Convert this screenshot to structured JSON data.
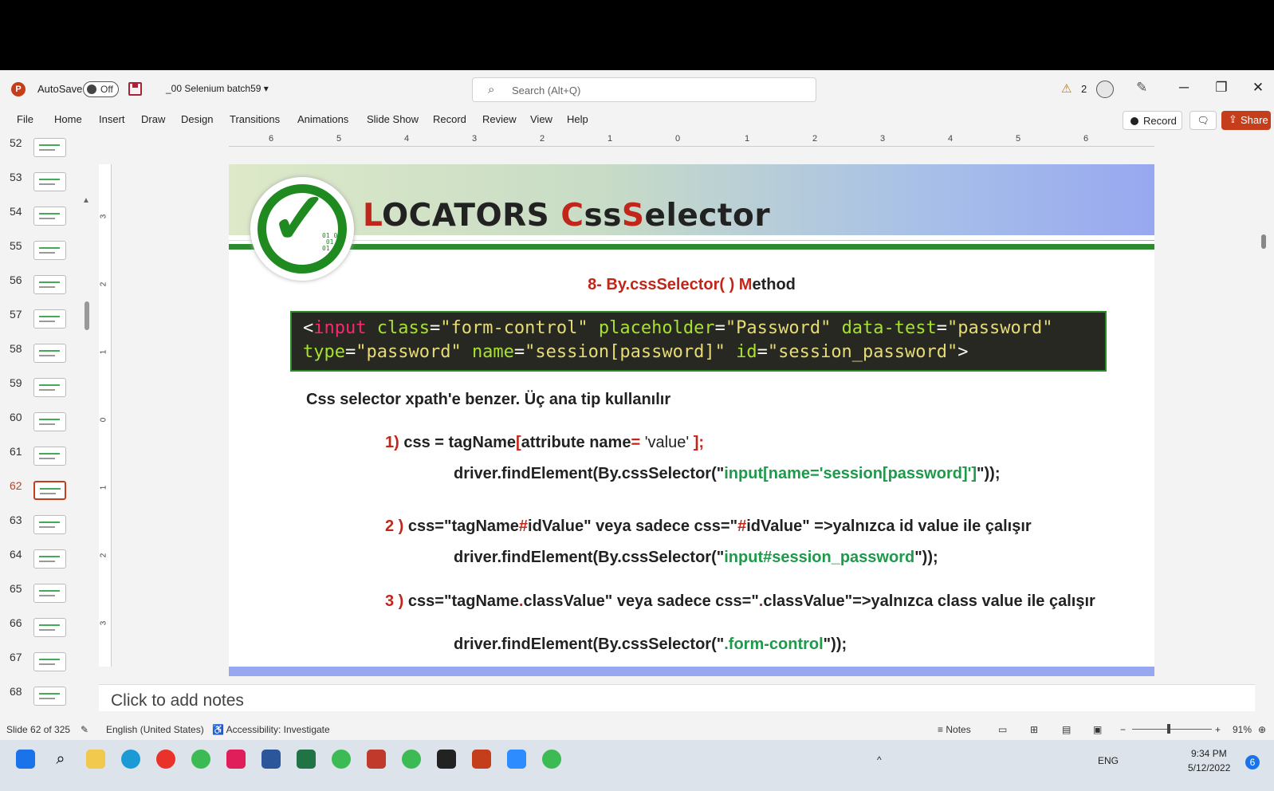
{
  "titlebar": {
    "app_logo": "P",
    "autosave_label": "AutoSave",
    "autosave_state": "Off",
    "file_name": "_00 Selenium batch59",
    "search_placeholder": "Search (Alt+Q)",
    "warnings_count": "2"
  },
  "menu": {
    "items": [
      "File",
      "Home",
      "Insert",
      "Draw",
      "Design",
      "Transitions",
      "Animations",
      "Slide Show",
      "Record",
      "Review",
      "View",
      "Help"
    ],
    "record_label": "Record",
    "share_label": "Share"
  },
  "thumbnails": {
    "numbers": [
      "52",
      "53",
      "54",
      "55",
      "56",
      "57",
      "58",
      "59",
      "60",
      "61",
      "62",
      "63",
      "64",
      "65",
      "66",
      "67",
      "68"
    ],
    "selected": "62"
  },
  "ruler": {
    "marks": [
      "6",
      "5",
      "4",
      "3",
      "2",
      "1",
      "0",
      "1",
      "2",
      "3",
      "4",
      "5",
      "6"
    ],
    "vertical_marks": [
      "3",
      "2",
      "1",
      "0",
      "1",
      "2",
      "3"
    ]
  },
  "slide": {
    "title_parts": [
      "L",
      "OCATORS ",
      "C",
      "ss",
      "S",
      "elector"
    ],
    "check_bits": "01 01\n 01\n01",
    "subtitle_red": "8- By.cssSelector( ) M",
    "subtitle_black": "ethod",
    "code": {
      "lt": "<",
      "tag": "input",
      "a1": "class",
      "v1": "\"form-control\"",
      "a2": "placeholder",
      "v2": "\"Password\"",
      "a3": "data-test",
      "v3": "\"password\"",
      "a4": "type",
      "v4": "\"password\"",
      "a5": "name",
      "v5": "\"session[password]\"",
      "a6": "id",
      "v6": "\"session_password\"",
      "gt": ">",
      "eq": "="
    },
    "intro": "Css selector xpath'e benzer. Üç ana tip kullanılır",
    "l1a": "1) ",
    "l1b": "css = tagName",
    "l1c": "[",
    "l1d": "attribute name",
    "l1e": "= ",
    "l1f": "'value'",
    "l1g": " ];",
    "l2a": "driver.findElement(By.cssSelector(\"",
    "l2b": "input[name='session[password]']",
    "l2c": "\"));",
    "l3a": "2 ) ",
    "l3b": "css=\"tagName",
    "l3c": "#",
    "l3d": "idValue\" veya sadece css=\"",
    "l3e": "#",
    "l3f": "idValue\" =>yalnızca id value ile çalışır",
    "l4a": "driver.findElement(By.cssSelector(\"",
    "l4b": "input#session_password",
    "l4c": "\"));",
    "l5a": "3 ) ",
    "l5b": "css=\"tagName",
    "l5c": ".",
    "l5d": "classValue\" veya sadece css=\"",
    "l5e": ".",
    "l5f": "classValue\"=>yalnızca class value ile çalışır",
    "l6a": "driver.findElement(By.cssSelector(\"",
    "l6b": ".form-control",
    "l6c": "\"));"
  },
  "notes_placeholder": "Click to add notes",
  "status": {
    "slide_info": "Slide 62 of 325",
    "language": "English (United States)",
    "accessibility": "Accessibility: Investigate",
    "notes_label": "Notes",
    "zoom": "91%"
  },
  "taskbar": {
    "lang": "ENG",
    "time": "9:34 PM",
    "date": "5/12/2022",
    "notif": "6"
  },
  "colors": {
    "accent": "#c43e1c",
    "title_red": "#c0261a",
    "code_green": "#1e9a4a"
  }
}
